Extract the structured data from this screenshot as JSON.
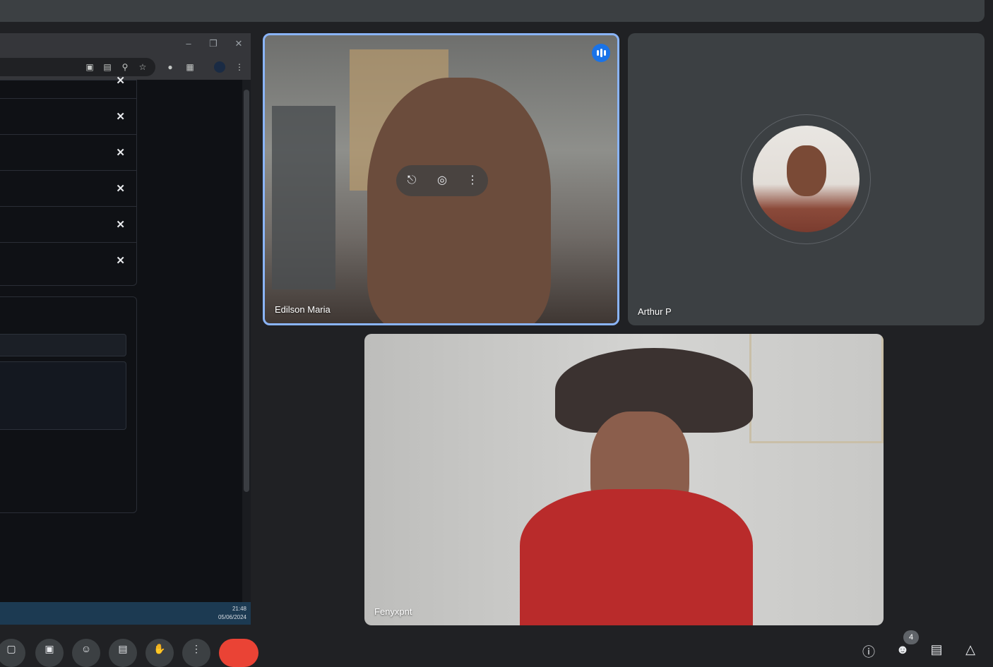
{
  "participants": [
    {
      "name": "Edilson Maria"
    },
    {
      "name": "Arthur P"
    },
    {
      "name": "Fenyxpnt"
    }
  ],
  "shared_window": {
    "clock_time": "21:48",
    "clock_date": "05/06/2024",
    "close_glyph": "✕"
  },
  "people_count": "4",
  "icons": {
    "speaking": "audio-level-icon",
    "pin": "pin-icon",
    "mic": "mic-icon",
    "more": "more-vert-icon"
  },
  "colors": {
    "active_speaker_border": "#8ab4f8",
    "speaking_badge": "#1a73e8",
    "end_call": "#ea4335"
  }
}
